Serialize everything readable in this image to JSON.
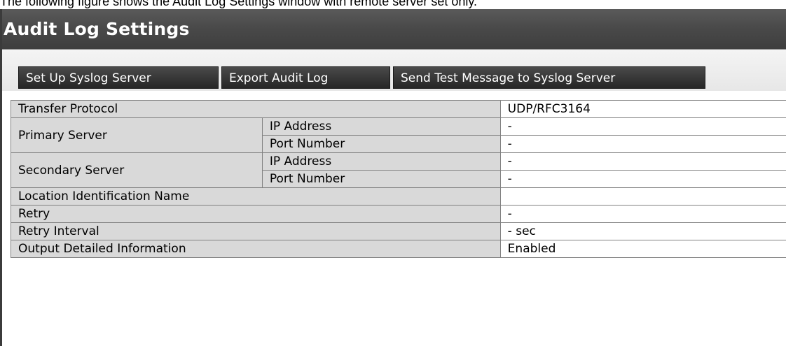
{
  "caption": "The following figure shows the Audit Log Settings window with remote server set only.",
  "window": {
    "title": "Audit Log Settings"
  },
  "toolbar": {
    "setup_syslog": "Set Up Syslog Server",
    "export_audit": "Export Audit Log",
    "send_test": "Send Test Message to Syslog Server"
  },
  "table": {
    "transfer_protocol": {
      "label": "Transfer Protocol",
      "value": "UDP/RFC3164"
    },
    "primary": {
      "label": "Primary Server",
      "ip_label": "IP Address",
      "ip_value": "-",
      "port_label": "Port Number",
      "port_value": "-"
    },
    "secondary": {
      "label": "Secondary Server",
      "ip_label": "IP Address",
      "ip_value": "-",
      "port_label": "Port Number",
      "port_value": "-"
    },
    "location": {
      "label": "Location Identification Name",
      "value": ""
    },
    "retry": {
      "label": "Retry",
      "value": "-"
    },
    "retry_interval": {
      "label": "Retry Interval",
      "value": "- sec"
    },
    "output_detailed": {
      "label": "Output Detailed Information",
      "value": "Enabled"
    }
  }
}
